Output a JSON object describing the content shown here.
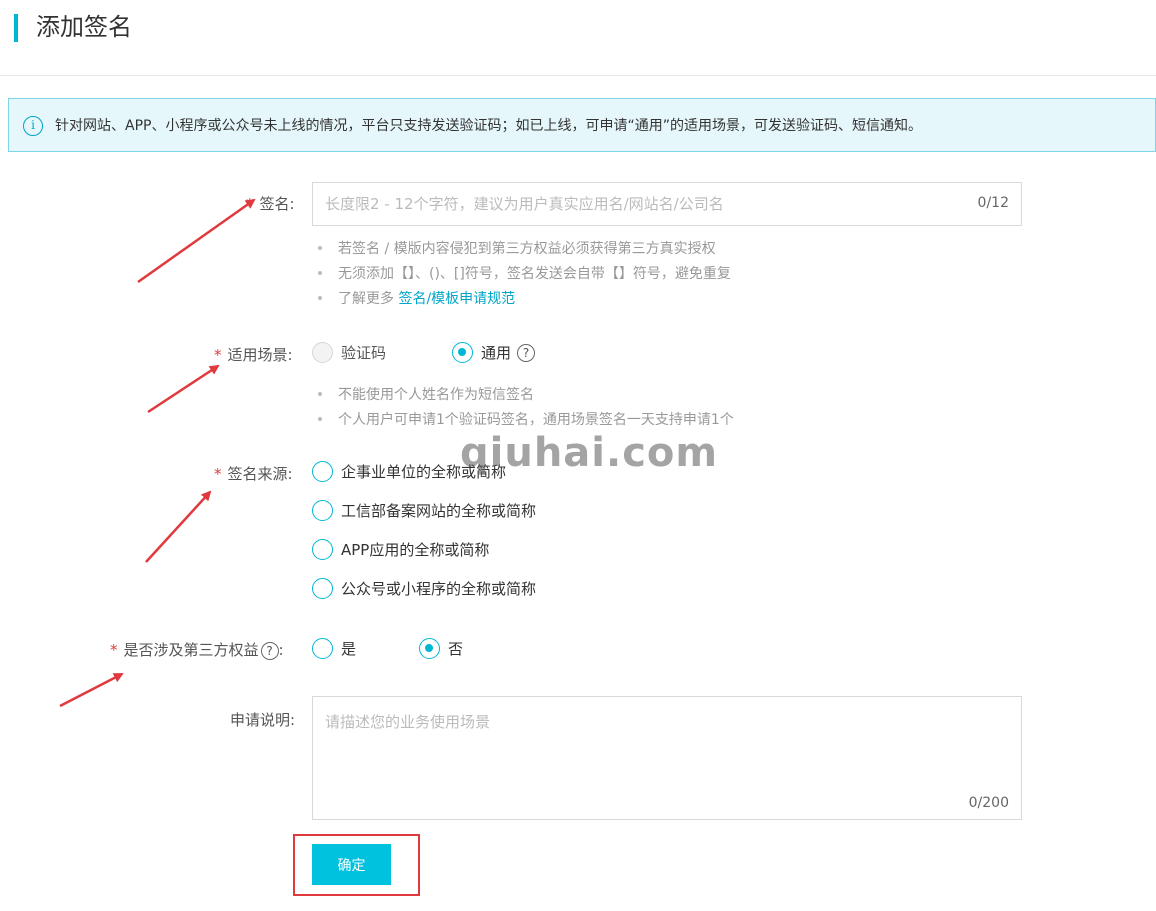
{
  "header": {
    "title": "添加签名"
  },
  "notice": {
    "icon": "info-icon",
    "text": "针对网站、APP、小程序或公众号未上线的情况，平台只支持发送验证码；如已上线，可申请“通用”的适用场景，可发送验证码、短信通知。"
  },
  "form": {
    "required_mark": "*",
    "signature": {
      "label": "签名:",
      "placeholder": "长度限2 - 12个字符，建议为用户真实应用名/网站名/公司名",
      "value": "",
      "counter": "0/12",
      "hints": [
        "若签名 / 模版内容侵犯到第三方权益必须获得第三方真实授权",
        "无须添加【】、()、[]符号，签名发送会自带【】符号，避免重复"
      ],
      "hint_more_prefix": "了解更多",
      "hint_more_link": "签名/模板申请规范"
    },
    "scene": {
      "label": "适用场景:",
      "options": [
        {
          "label": "验证码",
          "checked": false,
          "disabled": true
        },
        {
          "label": "通用",
          "checked": true,
          "disabled": false
        }
      ],
      "help_icon": "question-icon",
      "help_glyph": "?",
      "hints": [
        "不能使用个人姓名作为短信签名",
        "个人用户可申请1个验证码签名，通用场景签名一天支持申请1个"
      ]
    },
    "source": {
      "label": "签名来源:",
      "options": [
        {
          "label": "企事业单位的全称或简称",
          "checked": false
        },
        {
          "label": "工信部备案网站的全称或简称",
          "checked": false
        },
        {
          "label": "APP应用的全称或简称",
          "checked": false
        },
        {
          "label": "公众号或小程序的全称或简称",
          "checked": false
        }
      ]
    },
    "third_party": {
      "label": "是否涉及第三方权益",
      "label_suffix": ":",
      "help_glyph": "?",
      "options": [
        {
          "label": "是",
          "checked": false
        },
        {
          "label": "否",
          "checked": true
        }
      ]
    },
    "description": {
      "label": "申请说明:",
      "placeholder": "请描述您的业务使用场景",
      "value": "",
      "counter": "0/200"
    },
    "submit_label": "确定"
  },
  "watermark": "qiuhai.com",
  "colors": {
    "accent": "#00b8d4",
    "button": "#00c1de",
    "annotation": "#e0393e"
  }
}
